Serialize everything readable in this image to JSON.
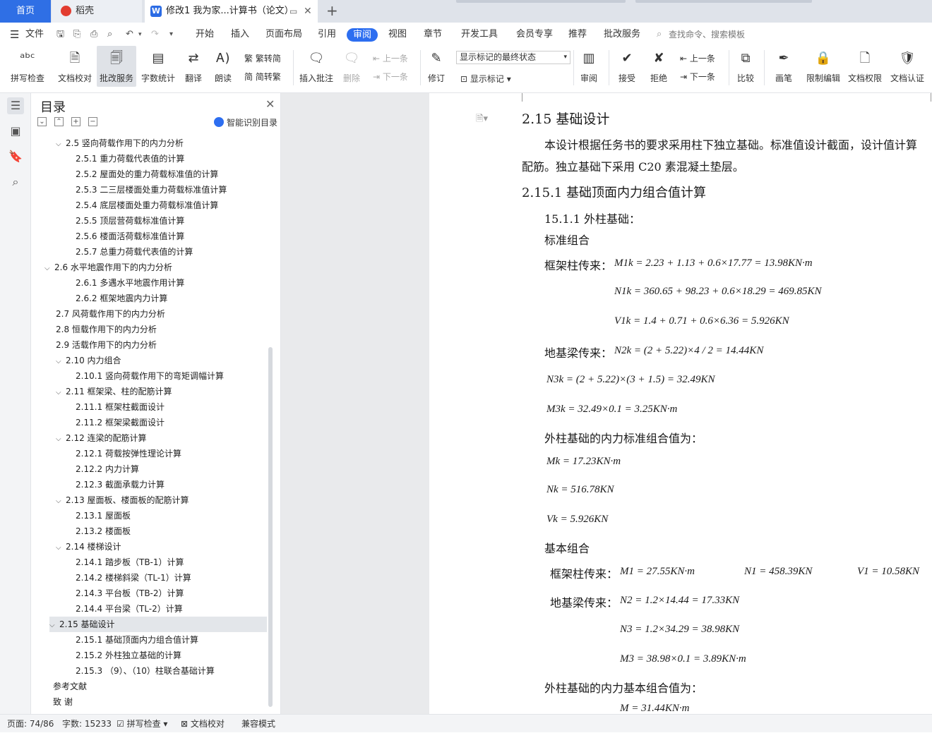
{
  "tabs": {
    "home": "首页",
    "daoke": "稻壳",
    "doc": "修改1 我为家...计算书（论文）",
    "plus": "+"
  },
  "menu": {
    "file": "文件",
    "items": [
      "开始",
      "插入",
      "页面布局",
      "引用",
      "审阅",
      "视图",
      "章节",
      "开发工具",
      "会员专享",
      "推荐",
      "批改服务"
    ],
    "active": "审阅",
    "search": "查找命令、搜索模板"
  },
  "ribbon": {
    "spell": "拼写检查",
    "proof": "文档校对",
    "review_service": "批改服务",
    "wordcount": "字数统计",
    "translate": "翻译",
    "read": "朗读",
    "trad": "繁转简",
    "simp": "简转繁",
    "insert_comment": "插入批注",
    "delete": "删除",
    "prev_comment": "上一条",
    "next_comment": "下一条",
    "track": "修订",
    "combo": "显示标记的最终状态",
    "show_markup": "显示标记",
    "review": "审阅",
    "accept": "接受",
    "reject": "拒绝",
    "prev": "上一条",
    "next": "下一条",
    "compare": "比较",
    "pen": "画笔",
    "restrict": "限制编辑",
    "rights": "文档权限",
    "certify": "文档认证"
  },
  "toc": {
    "title": "目录",
    "smart": "智能识别目录",
    "items": [
      {
        "t": "2.5  竖向荷载作用下的内力分析",
        "lvl": 1,
        "exp": true
      },
      {
        "t": "2.5.1  重力荷载代表值的计算",
        "lvl": 2
      },
      {
        "t": "2.5.2  屋面处的重力荷载标准值的计算",
        "lvl": 2
      },
      {
        "t": "2.5.3  二三层楼面处重力荷载标准值计算",
        "lvl": 2
      },
      {
        "t": "2.5.4 底层楼面处重力荷载标准值计算",
        "lvl": 2
      },
      {
        "t": "2.5.5 顶层营荷载标准值计算",
        "lvl": 2
      },
      {
        "t": "2.5.6 楼面活荷载标准值计算",
        "lvl": 2
      },
      {
        "t": "2.5.7 总重力荷载代表值的计算",
        "lvl": 2
      },
      {
        "t": "2.6 水平地震作用下的内力分析",
        "lvl": 0,
        "exp": true
      },
      {
        "t": "2.6.1  多遇水平地震作用计算",
        "lvl": 2
      },
      {
        "t": "2.6.2  框架地震内力计算",
        "lvl": 2
      },
      {
        "t": "2.7  风荷载作用下的内力分析",
        "lvl": 1
      },
      {
        "t": "2.8  恒载作用下的内力分析",
        "lvl": 1
      },
      {
        "t": "2.9  活载作用下的内力分析",
        "lvl": 1
      },
      {
        "t": "2.10  内力组合",
        "lvl": 1,
        "exp": true
      },
      {
        "t": "2.10.1  竖向荷载作用下的弯矩调幅计算",
        "lvl": 2
      },
      {
        "t": "2.11  框架梁、柱的配筋计算",
        "lvl": 1,
        "exp": true
      },
      {
        "t": "2.11.1  框架柱截面设计",
        "lvl": 2
      },
      {
        "t": "2.11.2  框架梁截面设计",
        "lvl": 2
      },
      {
        "t": "2.12  连梁的配筋计算",
        "lvl": 1,
        "exp": true
      },
      {
        "t": "2.12.1  荷载按弹性理论计算",
        "lvl": 2
      },
      {
        "t": "2.12.2  内力计算",
        "lvl": 2
      },
      {
        "t": "2.12.3  截面承载力计算",
        "lvl": 2
      },
      {
        "t": "2.13  屋面板、楼面板的配筋计算",
        "lvl": 1,
        "exp": true
      },
      {
        "t": "2.13.1  屋面板",
        "lvl": 2
      },
      {
        "t": "2.13.2  楼面板",
        "lvl": 2
      },
      {
        "t": "2.14  楼梯设计",
        "lvl": 1,
        "exp": true
      },
      {
        "t": "2.14.1 踏步板（TB-1）计算",
        "lvl": 2
      },
      {
        "t": "2.14.2  楼梯斜梁（TL-1）计算",
        "lvl": 2
      },
      {
        "t": "2.14.3  平台板（TB-2）计算",
        "lvl": 2
      },
      {
        "t": "2.14.4  平台梁（TL-2）计算",
        "lvl": 2
      },
      {
        "t": "2.15  基础设计",
        "lvl": 1,
        "exp": true,
        "sel": true
      },
      {
        "t": "2.15.1  基础顶面内力组合值计算",
        "lvl": 2
      },
      {
        "t": "2.15.2  外柱独立基础的计算",
        "lvl": 2
      },
      {
        "t": "2.15.3  （9）、（10）柱联合基础计算",
        "lvl": 2
      },
      {
        "t": "参考文献",
        "lvl": -1
      },
      {
        "t": "致    谢",
        "lvl": -1
      }
    ]
  },
  "doc": {
    "h215": "2.15  基础设计",
    "p1a": "本设计根据任务书的要求采用柱下独立基础。标准值设计截面，设计值计算",
    "p1b": "配筋。独立基础下采用 C20 素混凝土垫层。",
    "h2151": "2.15.1  基础顶面内力组合值计算",
    "s1": "15.1.1 外柱基础：",
    "std": "标准组合",
    "frame": "框架柱传来：",
    "eqM1k": "M1k = 2.23 + 1.13 + 0.6×17.77 = 13.98KN·m",
    "eqN1k": "N1k = 360.65 + 98.23 + 0.6×18.29 = 469.85KN",
    "eqV1k": "V1k = 1.4 + 0.71 + 0.6×6.36 = 5.926KN",
    "ground": "地基梁传来：",
    "eqN2k": "N2k = (2 + 5.22)×4 / 2 = 14.44KN",
    "eqN3k": "N3k = (2 + 5.22)×(3 + 1.5) = 32.49KN",
    "eqM3k": "M3k = 32.49×0.1 = 3.25KN·m",
    "stdres": "外柱基础的内力标准组合值为：",
    "eqMk": "Mk = 17.23KN·m",
    "eqNk": "Nk = 516.78KN",
    "eqVk": "Vk = 5.926KN",
    "basic": "基本组合",
    "frame2": "框架柱传来：",
    "eqM1": "M1 = 27.55KN·m",
    "eqN1": "N1 = 458.39KN",
    "eqV1": "V1 = 10.58KN",
    "ground2": "地基梁传来：",
    "eqN2": "N2 = 1.2×14.44 = 17.33KN",
    "eqN3": "N3 = 1.2×34.29 = 38.98KN",
    "eqM3": "M3 = 38.98×0.1 = 3.89KN·m",
    "basres": "外柱基础的内力基本组合值为：",
    "eqM": "M = 31.44KN·m"
  },
  "status": {
    "page": "页面: 74/86",
    "words": "字数: 15233",
    "spell": "拼写检查",
    "proof": "文档校对",
    "compat": "兼容模式"
  }
}
